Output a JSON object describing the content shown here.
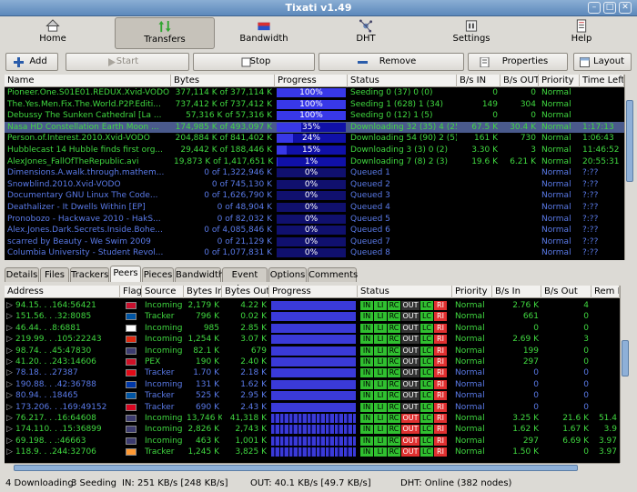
{
  "window": {
    "title": "Tixati v1.49"
  },
  "menu": [
    {
      "label": "Home",
      "icon": "home-icon"
    },
    {
      "label": "Transfers",
      "icon": "transfers-icon",
      "selected": true
    },
    {
      "label": "Bandwidth",
      "icon": "bandwidth-icon"
    },
    {
      "label": "DHT",
      "icon": "dht-icon"
    },
    {
      "label": "Settings",
      "icon": "settings-icon"
    },
    {
      "label": "Help",
      "icon": "help-icon"
    }
  ],
  "toolbar": {
    "add": "Add",
    "start": "Start",
    "stop": "Stop",
    "remove": "Remove",
    "properties": "Properties",
    "layout": "Layout"
  },
  "transfers": {
    "columns": [
      "Name",
      "Bytes",
      "Progress",
      "Status",
      "B/s IN",
      "B/s OUT",
      "Priority",
      "Time Left"
    ],
    "rows": [
      {
        "name": "Pioneer.One.S01E01.REDUX.Xvid-VODO",
        "bytes": "377,114 K of 377,114 K",
        "progress": 1.0,
        "ptext": "100%",
        "status": "Seeding 0 (37) 0 (0)",
        "in": "0",
        "out": "0",
        "priority": "Normal",
        "time": "",
        "color": "#40d840"
      },
      {
        "name": "The.Yes.Men.Fix.The.World.P2P.Editi...",
        "bytes": "737,412 K of 737,412 K",
        "progress": 1.0,
        "ptext": "100%",
        "status": "Seeding 1 (628) 1 (34)",
        "in": "149",
        "out": "304",
        "priority": "Normal",
        "time": "",
        "color": "#40d840"
      },
      {
        "name": "Debussy The Sunken Cathedral [La ...",
        "bytes": "57,316 K of 57,316 K",
        "progress": 1.0,
        "ptext": "100%",
        "status": "Seeding 0 (12) 1 (5)",
        "in": "0",
        "out": "0",
        "priority": "Normal",
        "time": "",
        "color": "#40d840"
      },
      {
        "name": "Nasa HD Constellation Earth Moon ...",
        "bytes": "174,985 K of 493,097 K",
        "progress": 0.35,
        "ptext": "35%",
        "status": "Downloading 32 (35) 4 (25)",
        "in": "67.5 K",
        "out": "30.4 K",
        "priority": "Normal",
        "time": "1:17:13",
        "color": "#40d840",
        "selected": true
      },
      {
        "name": "Person.of.Interest.2010.Xvid-VODO",
        "bytes": "204,884 K of 841,402 K",
        "progress": 0.24,
        "ptext": "24%",
        "status": "Downloading 54 (90) 2 (5)",
        "in": "161 K",
        "out": "730",
        "priority": "Normal",
        "time": "1:06:43",
        "color": "#40d840"
      },
      {
        "name": "Hubblecast 14 Hubble finds first org...",
        "bytes": "29,442 K of 188,446 K",
        "progress": 0.15,
        "ptext": "15%",
        "status": "Downloading 3 (3) 0 (2)",
        "in": "3.30 K",
        "out": "3",
        "priority": "Normal",
        "time": "11:46:52",
        "color": "#40d840"
      },
      {
        "name": "AlexJones_FallOfTheRepublic.avi",
        "bytes": "19,873 K of 1,417,651 K",
        "progress": 0.01,
        "ptext": "1%",
        "status": "Downloading 7 (8) 2 (3)",
        "in": "19.6 K",
        "out": "6.21 K",
        "priority": "Normal",
        "time": "20:55:31",
        "color": "#40d840"
      },
      {
        "name": "Dimensions.A.walk.through.mathem...",
        "bytes": "0 of 1,322,946 K",
        "progress": 0,
        "ptext": "0%",
        "status": "Queued 1",
        "in": "",
        "out": "",
        "priority": "Normal",
        "time": "?:??",
        "color": "#5a7ae8"
      },
      {
        "name": "Snowblind.2010.Xvid-VODO",
        "bytes": "0 of 745,130 K",
        "progress": 0,
        "ptext": "0%",
        "status": "Queued 2",
        "in": "",
        "out": "",
        "priority": "Normal",
        "time": "?:??",
        "color": "#5a7ae8"
      },
      {
        "name": "Documentary  GNU  Linux  The Code...",
        "bytes": "0 of 1,626,790 K",
        "progress": 0,
        "ptext": "0%",
        "status": "Queued 3",
        "in": "",
        "out": "",
        "priority": "Normal",
        "time": "?:??",
        "color": "#5a7ae8"
      },
      {
        "name": "Deathalizer - It Dwells Within [EP]",
        "bytes": "0 of 48,904 K",
        "progress": 0,
        "ptext": "0%",
        "status": "Queued 4",
        "in": "",
        "out": "",
        "priority": "Normal",
        "time": "?:??",
        "color": "#5a7ae8"
      },
      {
        "name": "Pronobozo - Hackwave 2010 - HakS...",
        "bytes": "0 of 82,032 K",
        "progress": 0,
        "ptext": "0%",
        "status": "Queued 5",
        "in": "",
        "out": "",
        "priority": "Normal",
        "time": "?:??",
        "color": "#5a7ae8"
      },
      {
        "name": "Alex.Jones.Dark.Secrets.Inside.Bohe...",
        "bytes": "0 of 4,085,846 K",
        "progress": 0,
        "ptext": "0%",
        "status": "Queued 6",
        "in": "",
        "out": "",
        "priority": "Normal",
        "time": "?:??",
        "color": "#5a7ae8"
      },
      {
        "name": "scarred by Beauty - We Swim 2009",
        "bytes": "0 of 21,129 K",
        "progress": 0,
        "ptext": "0%",
        "status": "Queued 7",
        "in": "",
        "out": "",
        "priority": "Normal",
        "time": "?:??",
        "color": "#5a7ae8"
      },
      {
        "name": "Columbia University - Student Revol...",
        "bytes": "0 of 1,077,831 K",
        "progress": 0,
        "ptext": "0%",
        "status": "Queued 8",
        "in": "",
        "out": "",
        "priority": "Normal",
        "time": "?:??",
        "color": "#5a7ae8"
      }
    ]
  },
  "detail_tabs": [
    "Details",
    "Files",
    "Trackers",
    "Peers",
    "Pieces",
    "Bandwidth",
    "Event Log",
    "Options",
    "Comments"
  ],
  "detail_tab_selected": 3,
  "peers": {
    "columns": [
      "Address",
      "Flag",
      "Source",
      "Bytes In",
      "Bytes Out",
      "Progress",
      "Status",
      "Priority",
      "B/s In",
      "B/s Out",
      "Rem B"
    ],
    "status_flags": [
      "IN",
      "LI",
      "RC",
      "OUT",
      "LC",
      "RI"
    ],
    "rows": [
      {
        "address": "94.15.   .   .164:56421",
        "flag": "#c8102e",
        "source": "Incoming",
        "bin": "2,179 K",
        "bout": "4.22 K",
        "progress": "full",
        "sf": [
          1,
          1,
          1,
          0,
          1,
          1
        ],
        "priority": "Normal",
        "in": "2.76 K",
        "out": "4",
        "rem": "",
        "color": "#40d840"
      },
      {
        "address": "151.56.   .   .32:8085",
        "flag": "#0055a4",
        "source": "Tracker",
        "bin": "796 K",
        "bout": "0.02 K",
        "progress": "full",
        "sf": [
          1,
          1,
          1,
          0,
          1,
          1
        ],
        "priority": "Normal",
        "in": "661",
        "out": "0",
        "rem": "",
        "color": "#40d840"
      },
      {
        "address": "46.44.   .   .8:6881",
        "flag": "#ffffff",
        "source": "Incoming",
        "bin": "985",
        "bout": "2.85 K",
        "progress": "full",
        "sf": [
          1,
          1,
          1,
          0,
          1,
          1
        ],
        "priority": "Normal",
        "in": "0",
        "out": "0",
        "rem": "",
        "color": "#40d840"
      },
      {
        "address": "219.99.   .   .105:22243",
        "flag": "#de2910",
        "source": "Incoming",
        "bin": "1,254 K",
        "bout": "3.07 K",
        "progress": "full",
        "sf": [
          1,
          1,
          1,
          0,
          1,
          1
        ],
        "priority": "Normal",
        "in": "2.69 K",
        "out": "3",
        "rem": "",
        "color": "#40d840"
      },
      {
        "address": "98.74.   .   .45:47830",
        "flag": "#3c3b6e",
        "source": "Incoming",
        "bin": "82.1 K",
        "bout": "679",
        "progress": "full",
        "sf": [
          1,
          1,
          1,
          0,
          1,
          1
        ],
        "priority": "Normal",
        "in": "199",
        "out": "0",
        "rem": "",
        "color": "#40d840"
      },
      {
        "address": "41.20.   .   .243:14606",
        "flag": "#ce1126",
        "source": "PEX",
        "bin": "190 K",
        "bout": "2.40 K",
        "progress": "full",
        "sf": [
          1,
          1,
          1,
          0,
          1,
          1
        ],
        "priority": "Normal",
        "in": "297",
        "out": "0",
        "rem": "",
        "color": "#40d840"
      },
      {
        "address": "78.18.   .   .27387",
        "flag": "#e30a17",
        "source": "Tracker",
        "bin": "1.70 K",
        "bout": "2.18 K",
        "progress": "full",
        "sf": [
          1,
          1,
          1,
          0,
          1,
          1
        ],
        "priority": "Normal",
        "in": "0",
        "out": "0",
        "rem": "",
        "color": "#5a7ae8"
      },
      {
        "address": "190.88.   .   .42:36788",
        "flag": "#0038a8",
        "source": "Incoming",
        "bin": "131 K",
        "bout": "1.62 K",
        "progress": "full",
        "sf": [
          1,
          1,
          1,
          0,
          1,
          1
        ],
        "priority": "Normal",
        "in": "0",
        "out": "0",
        "rem": "",
        "color": "#5a7ae8"
      },
      {
        "address": "80.94.   .   .18465",
        "flag": "#0055a4",
        "source": "Tracker",
        "bin": "525 K",
        "bout": "2.95 K",
        "progress": "full",
        "sf": [
          1,
          1,
          1,
          0,
          1,
          1
        ],
        "priority": "Normal",
        "in": "0",
        "out": "0",
        "rem": "",
        "color": "#5a7ae8"
      },
      {
        "address": "173.206.   .   .169:49152",
        "flag": "#d80621",
        "source": "Tracker",
        "bin": "690 K",
        "bout": "2.43 K",
        "progress": "full",
        "sf": [
          1,
          1,
          1,
          0,
          1,
          1
        ],
        "priority": "Normal",
        "in": "0",
        "out": "0",
        "rem": "",
        "color": "#5a7ae8"
      },
      {
        "address": "76.217.   .   .16:64608",
        "flag": "#3c3b6e",
        "source": "Incoming",
        "bin": "13,746 K",
        "bout": "41,318 K",
        "progress": "partial",
        "sf": [
          1,
          1,
          1,
          1,
          1,
          1
        ],
        "priority": "Normal",
        "in": "3.25 K",
        "out": "21.6 K",
        "rem": "51.4",
        "color": "#40d840"
      },
      {
        "address": "174.110.   .   .15:36899",
        "flag": "#3c3b6e",
        "source": "Incoming",
        "bin": "2,826 K",
        "bout": "2,743 K",
        "progress": "partial",
        "sf": [
          1,
          1,
          1,
          1,
          1,
          1
        ],
        "priority": "Normal",
        "in": "1.62 K",
        "out": "1.67 K",
        "rem": "3.9",
        "color": "#40d840"
      },
      {
        "address": "69.198.   .   .:46663",
        "flag": "#3c3b6e",
        "source": "Incoming",
        "bin": "463 K",
        "bout": "1,001 K",
        "progress": "partial",
        "sf": [
          1,
          1,
          1,
          1,
          1,
          1
        ],
        "priority": "Normal",
        "in": "297",
        "out": "6.69 K",
        "rem": "3.97",
        "color": "#40d840"
      },
      {
        "address": "118.9.   .   .244:32706",
        "flag": "#ff9933",
        "source": "Tracker",
        "bin": "1,245 K",
        "bout": "3,825 K",
        "progress": "partial",
        "sf": [
          1,
          1,
          1,
          1,
          1,
          1
        ],
        "priority": "Normal",
        "in": "1.50 K",
        "out": "0",
        "rem": "3.97",
        "color": "#40d840"
      }
    ]
  },
  "status": {
    "downloading": "4 Downloading",
    "seeding": "3 Seeding",
    "in": "IN: 251 KB/s [248 KB/s]",
    "out": "OUT: 40.1 KB/s [49.7 KB/s]",
    "dht": "DHT: Online (382 nodes)"
  }
}
